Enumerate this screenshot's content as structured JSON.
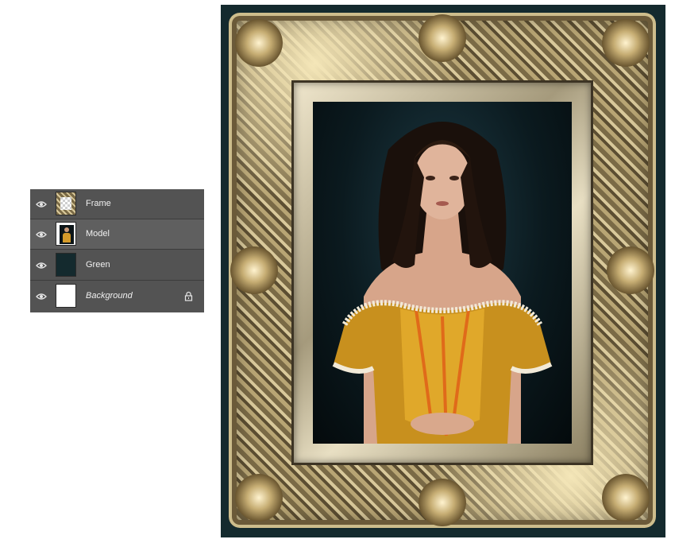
{
  "layers_panel": {
    "layers": [
      {
        "name": "Frame",
        "italic": false,
        "selected": false,
        "locked": false,
        "visible": true
      },
      {
        "name": "Model",
        "italic": false,
        "selected": true,
        "locked": false,
        "visible": true
      },
      {
        "name": "Green",
        "italic": false,
        "selected": false,
        "locked": false,
        "visible": true
      },
      {
        "name": "Background",
        "italic": true,
        "selected": false,
        "locked": true,
        "visible": true
      }
    ],
    "icons": {
      "visibility": "eye-icon",
      "lock": "lock-icon"
    }
  },
  "colors": {
    "panel_bg": "#535353",
    "panel_selected": "#5f5f5f",
    "canvas_bg": "#142a2e",
    "green_layer": "#142a2e",
    "text": "#f0f0f0"
  }
}
